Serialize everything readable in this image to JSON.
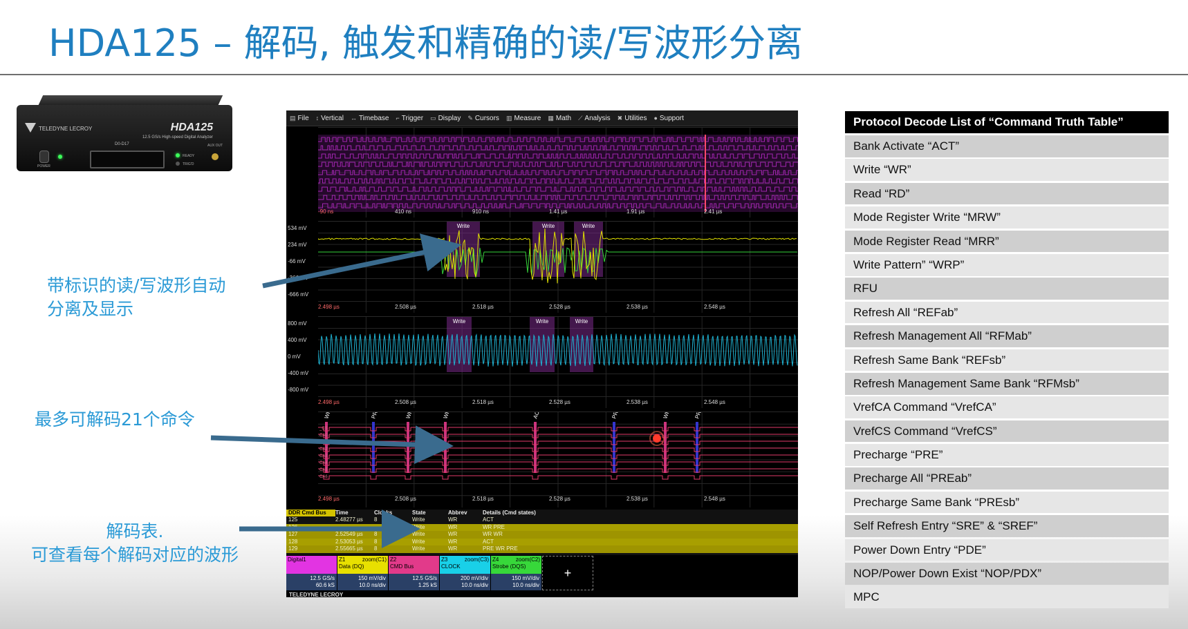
{
  "slide": {
    "title": "HDA125 – 解码, 触发和精确的读/写波形分离"
  },
  "device": {
    "brand": "TELEDYNE LECROY",
    "model": "HDA125",
    "subtitle": "12.5 GS/s High-speed Digital Analyzer",
    "port_label": "D0-D17",
    "power_label": "POWER",
    "ready_label": "READY",
    "trig_label": "TRIG'D",
    "aux_label": "AUX OUT"
  },
  "scope": {
    "menu": [
      {
        "icon": "▤",
        "label": "File"
      },
      {
        "icon": "↕",
        "label": "Vertical"
      },
      {
        "icon": "↔",
        "label": "Timebase"
      },
      {
        "icon": "⌐",
        "label": "Trigger"
      },
      {
        "icon": "▭",
        "label": "Display"
      },
      {
        "icon": "✎",
        "label": "Cursors"
      },
      {
        "icon": "▥",
        "label": "Measure"
      },
      {
        "icon": "▦",
        "label": "Math"
      },
      {
        "icon": "⟋",
        "label": "Analysis"
      },
      {
        "icon": "✖",
        "label": "Utilities"
      },
      {
        "icon": "●",
        "label": "Support"
      }
    ],
    "digital_panel": {
      "time_labels": [
        "-90 ns",
        "410 ns",
        "910 ns",
        "1.41 µs",
        "1.91 µs",
        "2.41 µs"
      ]
    },
    "dq_panel": {
      "y_labels": [
        "534 mV",
        "234 mV",
        "-66 mV",
        "-366 mV",
        "-666 mV"
      ],
      "time_labels": [
        "2.498 µs",
        "2.508 µs",
        "2.518 µs",
        "2.528 µs",
        "2.538 µs",
        "2.548 µs"
      ],
      "tags": [
        "Write",
        "Write",
        "Write"
      ]
    },
    "clock_panel": {
      "y_labels": [
        "800 mV",
        "400 mV",
        "0 mV",
        "-400 mV",
        "-800 mV"
      ],
      "time_labels": [
        "2.498 µs",
        "2.508 µs",
        "2.518 µs",
        "2.528 µs",
        "2.538 µs",
        "2.548 µs"
      ],
      "tags": [
        "Write",
        "Write",
        "Write"
      ]
    },
    "cmd_panel": {
      "decode_tags": [
        "WR",
        "PRE",
        "WR",
        "WR",
        "ACT",
        "PRE",
        "WR",
        "PRE"
      ],
      "channel_labels": [
        "_CS",
        "CA0",
        "CA1",
        "CA2",
        "CA3",
        "CA4",
        "CA5",
        "CA6"
      ],
      "time_labels": [
        "2.498 µs",
        "2.508 µs",
        "2.518 µs",
        "2.528 µs",
        "2.538 µs",
        "2.548 µs"
      ]
    },
    "decode_table": {
      "headers": [
        "DDR Cmd Bus",
        "Time",
        "Clocks",
        "State",
        "Abbrev",
        "Details (Cmd states)"
      ],
      "rows": [
        [
          "125",
          "2.48277 µs",
          "8",
          "Write",
          "WR",
          "ACT"
        ],
        [
          "126",
          "",
          "",
          "Write",
          "WR",
          "WR PRE"
        ],
        [
          "127",
          "2.52549 µs",
          "8",
          "Write",
          "WR",
          "WR WR"
        ],
        [
          "128",
          "2.53053 µs",
          "8",
          "Write",
          "WR",
          "ACT"
        ],
        [
          "129",
          "2.55665 µs",
          "8",
          "Write",
          "WR",
          "PRE WR PRE"
        ]
      ]
    },
    "descriptors": [
      {
        "name": "Digital1",
        "line1": "",
        "value1": "12.5 GS/s",
        "value2": "60.6 kS",
        "color": "#e234e2"
      },
      {
        "name": "Z1",
        "line1": "Data (DQ)",
        "zoom": "zoom(C1)",
        "value1": "150 mV/div",
        "value2": "10.0 ns/div",
        "color": "#e8e000"
      },
      {
        "name": "Z2",
        "line1": "CMD Bus",
        "zoom": "",
        "value1": "12.5 GS/s",
        "value2": "1.25 kS",
        "color": "#e23a8a"
      },
      {
        "name": "Z3",
        "line1": "CLOCK",
        "zoom": "zoom(C3)",
        "value1": "200 mV/div",
        "value2": "10.0 ns/div",
        "color": "#19d0e8"
      },
      {
        "name": "Z4",
        "line1": "Strobe (DQS)",
        "zoom": "zoom(C2)",
        "value1": "150 mV/div",
        "value2": "10.0 ns/div",
        "color": "#37d83a"
      }
    ],
    "add_label": "+",
    "brand": "TELEDYNE LECROY"
  },
  "annotations": {
    "note1": [
      "带标识的读/写波形自动",
      "分离及显示"
    ],
    "note2": "最多可解码21个命令",
    "note3": [
      "解码表.",
      "可查看每个解码对应的波形"
    ]
  },
  "command_list": {
    "header": "Protocol Decode List of “Command Truth Table”",
    "items": [
      "Bank Activate “ACT”",
      "Write “WR”",
      "Read “RD”",
      "Mode Register Write “MRW”",
      "Mode Register Read “MRR”",
      "Write Pattern” “WRP”",
      "RFU",
      "Refresh All “REFab”",
      "Refresh Management All “RFMab”",
      "Refresh Same Bank “REFsb”",
      "Refresh Management Same Bank “RFMsb”",
      "VrefCA Command “VrefCA”",
      "VrefCS Command “VrefCS”",
      "Precharge “PRE”",
      "Precharge All “PREab”",
      "Precharge Same Bank “PREsb”",
      "Self Refresh Entry “SRE” & “SREF”",
      "Power Down Entry “PDE”",
      "NOP/Power Down Exist “NOP/PDX”",
      "MPC"
    ]
  },
  "colors": {
    "title_blue": "#1f7fc0",
    "note_blue": "#2b9ad6",
    "arrow": "#3a6b8e"
  }
}
